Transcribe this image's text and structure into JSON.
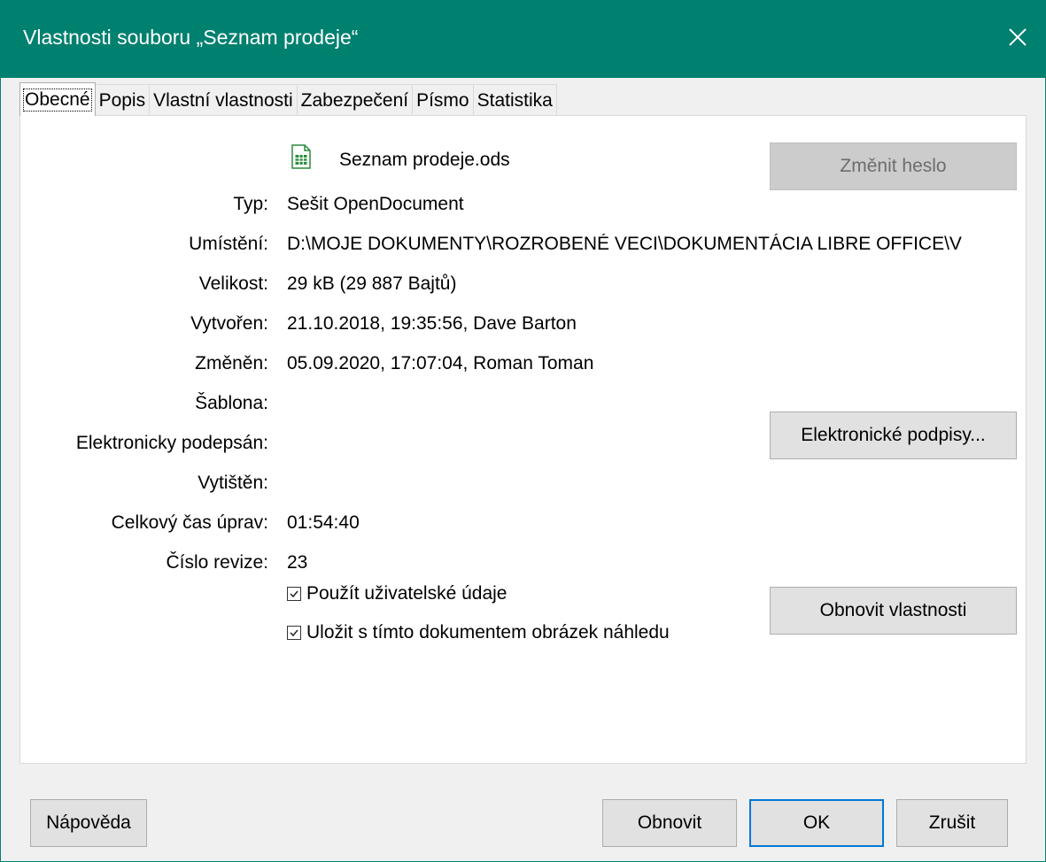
{
  "window": {
    "title": "Vlastnosti souboru „Seznam prodeje“",
    "close_icon": "close-icon",
    "accent_color": "#00806f"
  },
  "tabs": [
    {
      "label": "Obecné",
      "active": true
    },
    {
      "label": "Popis"
    },
    {
      "label": "Vlastní vlastnosti"
    },
    {
      "label": "Zabezpečení"
    },
    {
      "label": "Písmo"
    },
    {
      "label": "Statistika"
    }
  ],
  "general": {
    "file_icon": "spreadsheet-icon",
    "file_name": "Seznam prodeje.ods",
    "type_label": "Typ:",
    "type_value": "Sešit OpenDocument",
    "location_label": "Umístění:",
    "location_value": "D:\\MOJE DOKUMENTY\\ROZROBENÉ VECI\\DOKUMENTÁCIA LIBRE OFFICE\\V",
    "size_label": "Velikost:",
    "size_value": "29 kB (29 887 Bajtů)",
    "created_label": "Vytvořen:",
    "created_value": "21.10.2018, 19:35:56, Dave Barton",
    "modified_label": "Změněn:",
    "modified_value": "05.09.2020, 17:07:04, Roman Toman",
    "template_label": "Šablona:",
    "signed_label": "Elektronicky podepsán:",
    "printed_label": "Vytištěn:",
    "edit_time_label": "Celkový čas úprav:",
    "edit_time_value": "01:54:40",
    "revision_label": "Číslo revize:",
    "revision_value": "23",
    "use_user_data_label": "Použít uživatelské údaje",
    "use_user_data_checked": true,
    "save_thumbnail_label": "Uložit s tímto dokumentem obrázek náhledu",
    "save_thumbnail_checked": true,
    "change_password_label": "Změnit heslo",
    "digital_signatures_label": "Elektronické podpisy...",
    "reset_properties_label": "Obnovit vlastnosti"
  },
  "footer": {
    "help_label": "Nápověda",
    "reset_label": "Obnovit",
    "ok_label": "OK",
    "cancel_label": "Zrušit"
  }
}
